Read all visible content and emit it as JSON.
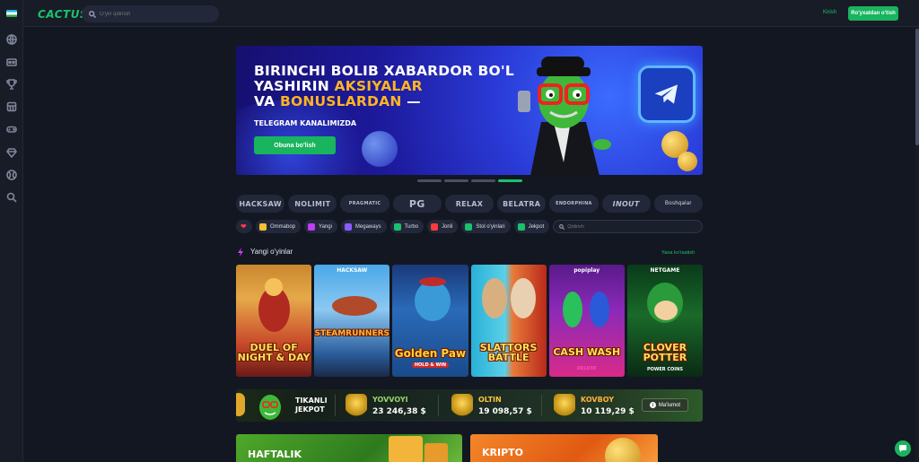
{
  "header": {
    "logo": "CACTUS",
    "search_placeholder": "O'yin qidirish",
    "login": "Kirish",
    "register": "Ro'yxatdan o'tish"
  },
  "sidebar": {
    "icons": [
      "flag-uz",
      "globe-icon",
      "casino-icon",
      "trophy-icon",
      "slot-icon",
      "gamepad-icon",
      "diamond-icon",
      "sports-icon",
      "search-icon"
    ]
  },
  "banner": {
    "line1": "BIRINCHI BOLIB XABARDOR BO'L",
    "line2a": "YASHIRIN ",
    "line2b": "AKSIYALAR",
    "line3a": "VA ",
    "line3b": "BONUSLARDAN",
    "line3c": " —",
    "sub": "TELEGRAM KANALIMIZDA",
    "button": "Obuna bo'lish",
    "slides": 4,
    "active_slide": 4
  },
  "providers": [
    "HACKSAW",
    "NOLIMIT",
    "PRAGMATIC",
    "PG",
    "RELAX",
    "BELATRA",
    "ENDORPHINA",
    "INOUT",
    "Boshqalar"
  ],
  "filters": {
    "chips": [
      {
        "label": "Ommabop",
        "color": "#f2c230"
      },
      {
        "label": "Yangi",
        "color": "#c23bff"
      },
      {
        "label": "Megaways",
        "color": "#8a5cff"
      },
      {
        "label": "Turbo",
        "color": "#19c36b"
      },
      {
        "label": "Jonli",
        "color": "#ff3b3b"
      },
      {
        "label": "Stol o'yinlari",
        "color": "#19c36b"
      },
      {
        "label": "Jekpot",
        "color": "#19c36b"
      }
    ],
    "search_placeholder": "Qidirish"
  },
  "new_games": {
    "title": "Yangi o'yinlar",
    "see_all": "Yana ko'rsatish",
    "games": [
      {
        "title": "DUEL OF NIGHT & DAY",
        "brand": "",
        "sub": ""
      },
      {
        "title": "STEAMRUNNERS",
        "brand": "HACKSAW",
        "sub": ""
      },
      {
        "title": "Golden Paw",
        "brand": "",
        "sub": "HOLD & WIN"
      },
      {
        "title": "SLATTORS BATTLE",
        "brand": "",
        "sub": ""
      },
      {
        "title": "CASH WASH",
        "brand": "popiplay",
        "sub": "DELUXE"
      },
      {
        "title": "CLOVER POTTER",
        "brand": "NETGAME",
        "sub": "POWER COINS"
      }
    ]
  },
  "jackpot": {
    "title_line1": "TIKANLI",
    "title_line2": "JEKPOT",
    "items": [
      {
        "name": "YOVVOYI",
        "amount": "23 246,38 $",
        "color": "#9bd46b"
      },
      {
        "name": "OLTIN",
        "amount": "19 098,57 $",
        "color": "#ffc83a"
      },
      {
        "name": "KOVBOY",
        "amount": "10 119,29 $",
        "color": "#ffb43a"
      }
    ],
    "button": "Ma'lumot"
  },
  "promos": [
    {
      "title": "HAFTALIK"
    },
    {
      "title": "KRIPTO"
    }
  ],
  "colors": {
    "accent": "#19c36b",
    "background": "#131722",
    "panel": "#222839"
  }
}
